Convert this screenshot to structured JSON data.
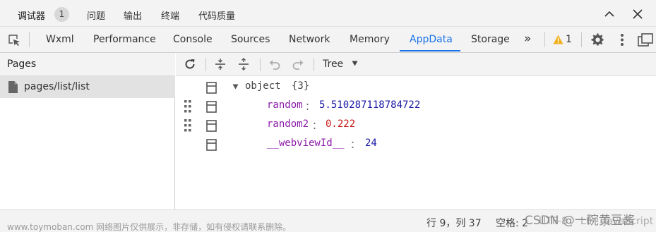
{
  "top_tabs": {
    "debugger": "调试器",
    "badge": "1",
    "issues": "问题",
    "output": "输出",
    "terminal": "终端",
    "quality": "代码质量"
  },
  "dev_tabs": [
    "Wxml",
    "Performance",
    "Console",
    "Sources",
    "Network",
    "Memory",
    "AppData",
    "Storage"
  ],
  "dev_more": "»",
  "warning_count": "1",
  "sidebar": {
    "title": "Pages",
    "items": [
      {
        "label": "pages/list/list"
      }
    ]
  },
  "toolbar": {
    "view_mode": "Tree"
  },
  "tree": {
    "root_label": "object",
    "root_count": "{3}",
    "rows": [
      {
        "key": "random",
        "colon": "：",
        "value": "5.510287118784722"
      },
      {
        "key": "random2",
        "colon": "：",
        "value": "0.222"
      },
      {
        "key": "__webviewId__",
        "colon": "：",
        "value": "24"
      }
    ]
  },
  "status": {
    "cursor": "行 9，列 37",
    "spaces": "空格: 2",
    "encoding": "UTF-8",
    "eol": "LF",
    "language": "JavaScript"
  },
  "watermark": {
    "left": "www.toymoban.com 网络图片仅供展示，非存储，如有侵权请联系删除。",
    "right": "CSDN @一碗黄豆酱"
  },
  "colors": {
    "accent": "#1a73e8",
    "warning": "#f2b01e",
    "key": "#8c1aa8",
    "number": "#1a1aa6",
    "number_alt": "#c41a16"
  }
}
